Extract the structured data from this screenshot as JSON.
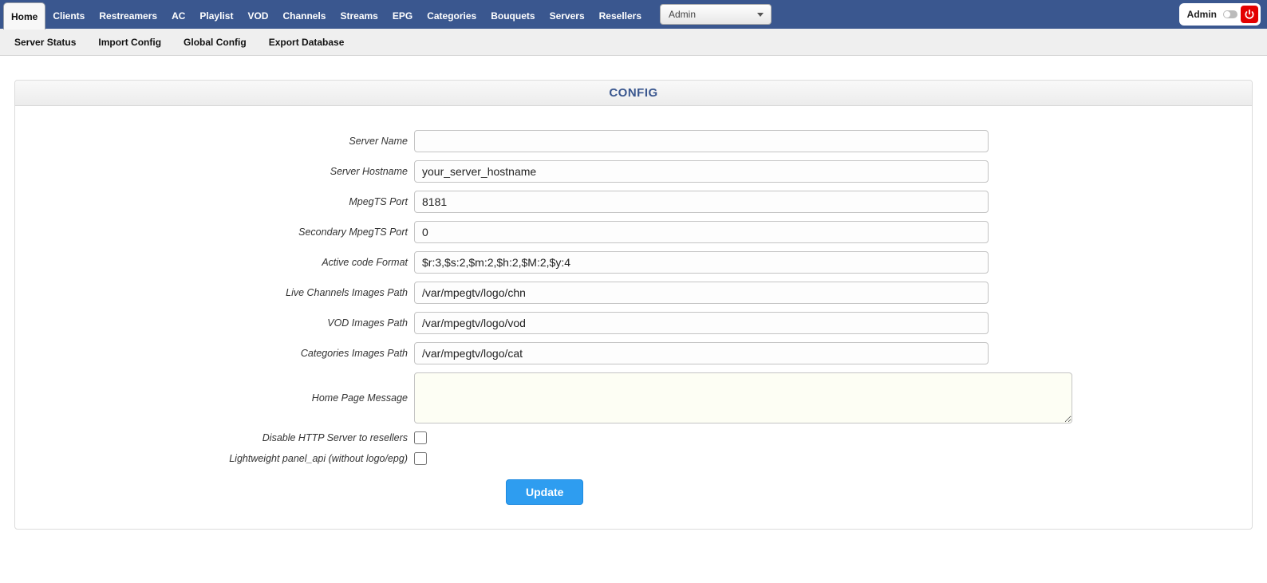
{
  "topnav": {
    "items": [
      {
        "label": "Home",
        "active": true
      },
      {
        "label": "Clients",
        "active": false
      },
      {
        "label": "Restreamers",
        "active": false
      },
      {
        "label": "AC",
        "active": false
      },
      {
        "label": "Playlist",
        "active": false
      },
      {
        "label": "VOD",
        "active": false
      },
      {
        "label": "Channels",
        "active": false
      },
      {
        "label": "Streams",
        "active": false
      },
      {
        "label": "EPG",
        "active": false
      },
      {
        "label": "Categories",
        "active": false
      },
      {
        "label": "Bouquets",
        "active": false
      },
      {
        "label": "Servers",
        "active": false
      },
      {
        "label": "Resellers",
        "active": false
      }
    ],
    "admin_select_value": "Admin"
  },
  "topbar_right": {
    "user_label": "Admin"
  },
  "subnav": {
    "items": [
      {
        "label": "Server Status"
      },
      {
        "label": "Import Config"
      },
      {
        "label": "Global Config"
      },
      {
        "label": "Export Database"
      }
    ]
  },
  "panel": {
    "title": "CONFIG"
  },
  "form": {
    "server_name": {
      "label": "Server Name",
      "value": ""
    },
    "server_hostname": {
      "label": "Server Hostname",
      "value": "your_server_hostname"
    },
    "mpegts_port": {
      "label": "MpegTS Port",
      "value": "8181"
    },
    "secondary_mpegts_port": {
      "label": "Secondary MpegTS Port",
      "value": "0"
    },
    "active_code_format": {
      "label": "Active code Format",
      "value": "$r:3,$s:2,$m:2,$h:2,$M:2,$y:4"
    },
    "live_channels_images": {
      "label": "Live Channels Images Path",
      "value": "/var/mpegtv/logo/chn"
    },
    "vod_images_path": {
      "label": "VOD Images Path",
      "value": "/var/mpegtv/logo/vod"
    },
    "categories_images_path": {
      "label": "Categories Images Path",
      "value": "/var/mpegtv/logo/cat"
    },
    "home_page_message": {
      "label": "Home Page Message",
      "value": ""
    },
    "disable_http_server": {
      "label": "Disable HTTP Server to resellers",
      "checked": false
    },
    "lightweight_panel_api": {
      "label": "Lightweight panel_api (without logo/epg)",
      "checked": false
    }
  },
  "buttons": {
    "update": "Update"
  }
}
